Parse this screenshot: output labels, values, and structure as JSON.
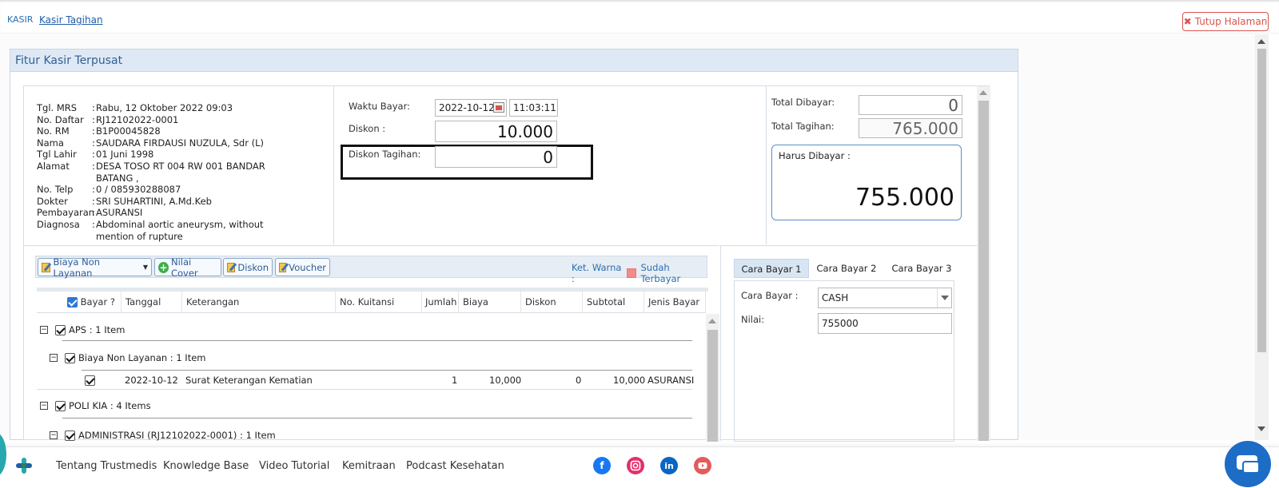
{
  "breadcrumb": {
    "root": "KASIR",
    "current": "Kasir Tagihan"
  },
  "close_button": {
    "label": "Tutup Halaman"
  },
  "panel": {
    "title": "Fitur Kasir Terpusat"
  },
  "patient": [
    {
      "label": "Tgl. MRS",
      "value": "Rabu, 12 Oktober 2022 09:03"
    },
    {
      "label": "No. Daftar",
      "value": "RJ12102022-0001"
    },
    {
      "label": "No. RM",
      "value": "B1P00045828"
    },
    {
      "label": "Nama",
      "value": "SAUDARA FIRDAUSI NUZULA, Sdr (L)"
    },
    {
      "label": "Tgl Lahir",
      "value": "01 Juni 1998"
    },
    {
      "label": "Alamat",
      "value": "DESA TOSO RT 004 RW 001 BANDAR BATANG ,"
    },
    {
      "label": "No. Telp",
      "value": "0 / 085930288087"
    },
    {
      "label": "Dokter",
      "value": "SRI SUHARTINI, A.Md.Keb"
    },
    {
      "label": "Pembayaran",
      "value": "ASURANSI"
    },
    {
      "label": "Diagnosa",
      "value": "Abdominal aortic aneurysm, without mention of rupture"
    }
  ],
  "payment_time": {
    "label": "Waktu Bayar:",
    "date": "2022-10-12",
    "time": "11:03:11",
    "discount_label": "Diskon :",
    "discount_value": "10.000",
    "bill_discount_label": "Diskon Tagihan:",
    "bill_discount_value": "0"
  },
  "totals": {
    "paid_label": "Total Dibayar:",
    "paid_value": "0",
    "bill_label": "Total Tagihan:",
    "bill_value": "765.000",
    "due_label": "Harus Dibayar :",
    "due_value": "755.000"
  },
  "toolbar": {
    "non_service": "Biaya Non Layanan",
    "cover_value": "Nilai Cover",
    "discount": "Diskon",
    "voucher": "Voucher",
    "legend_label": "Ket. Warna :",
    "legend_paid": "Sudah Terbayar"
  },
  "grid": {
    "columns": [
      "Bayar ?",
      "Tanggal",
      "Keterangan",
      "No. Kuitansi",
      "Jumlah",
      "Biaya",
      "Diskon",
      "Subtotal",
      "Jenis Bayar"
    ],
    "groups": [
      {
        "label": "APS : 1 Item"
      },
      {
        "label": "Biaya Non Layanan : 1 Item"
      },
      {
        "label": "POLI KIA : 4 Items"
      },
      {
        "label": "ADMINISTRASI (RJ12102022-0001) : 1 Item"
      }
    ],
    "row": {
      "date": "2022-10-12",
      "desc": "Surat Keterangan Kematian",
      "qty": "1",
      "cost": "10,000",
      "discount": "0",
      "subtotal": "10,000",
      "pay_type": "ASURANSI"
    }
  },
  "pay_methods": {
    "tabs": [
      "Cara Bayar 1",
      "Cara Bayar 2",
      "Cara Bayar 3"
    ],
    "method_label": "Cara Bayar :",
    "method_value": "CASH",
    "amount_label": "Nilai:",
    "amount_value": "755000"
  },
  "footer": {
    "links": [
      "Tentang Trustmedis",
      "Knowledge Base",
      "Video Tutorial",
      "Kemitraan",
      "Podcast Kesehatan"
    ],
    "social": [
      "facebook-icon",
      "instagram-icon",
      "linkedin-icon",
      "youtube-icon"
    ]
  },
  "colors": {
    "accent": "#2f5f94",
    "danger": "#d9534f",
    "chat": "#1d6dc7",
    "facebook": "#1877f2",
    "instagram": "#e1306c",
    "linkedin": "#0a66c2",
    "youtube": "#e45b5b"
  }
}
